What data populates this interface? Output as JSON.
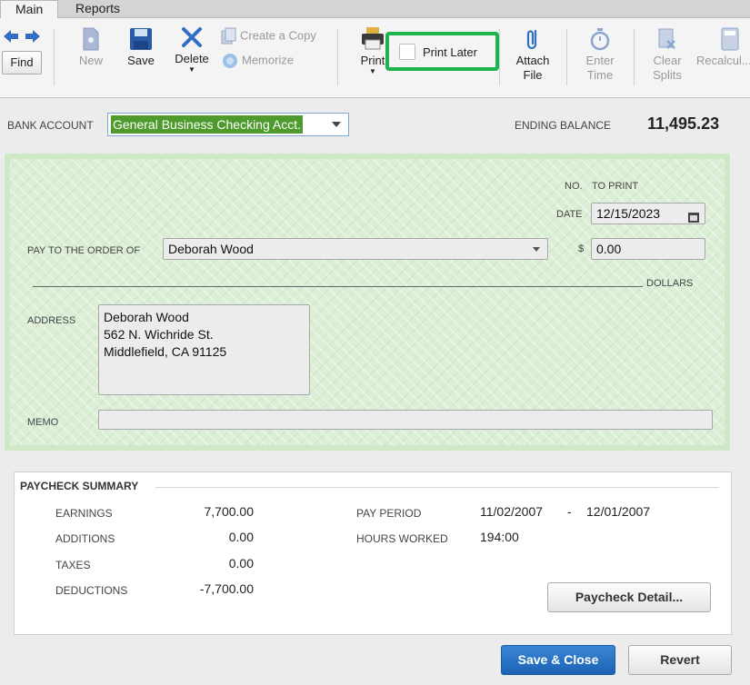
{
  "tabs": [
    {
      "label": "Main"
    },
    {
      "label": "Reports"
    }
  ],
  "toolbar": {
    "find_label": "Find",
    "new_label": "New",
    "save_label": "Save",
    "delete_label": "Delete",
    "create_copy_label": "Create a Copy",
    "memorize_label": "Memorize",
    "print_label": "Print",
    "print_later_label": "Print Later",
    "attach_label_1": "Attach",
    "attach_label_2": "File",
    "enter_label_1": "Enter",
    "enter_label_2": "Time",
    "clear_label_1": "Clear",
    "clear_label_2": "Splits",
    "recalc_label": "Recalcul..."
  },
  "bank": {
    "label": "BANK ACCOUNT",
    "value": "General Business Checking Acct.",
    "ending_balance_label": "ENDING BALANCE",
    "ending_balance": "11,495.23"
  },
  "check": {
    "no_label": "NO.",
    "no_value": "TO PRINT",
    "date_label": "DATE",
    "date_value": "12/15/2023",
    "pay_to_label": "PAY TO THE ORDER OF",
    "payee": "Deborah Wood",
    "dollar_sign": "$",
    "amount": "0.00",
    "dollars_label": "DOLLARS",
    "address_label": "ADDRESS",
    "address_lines": [
      "Deborah Wood",
      "562 N. Wichride St.",
      "Middlefield, CA 91125"
    ],
    "memo_label": "MEMO"
  },
  "summary": {
    "title": "PAYCHECK SUMMARY",
    "earnings_label": "EARNINGS",
    "earnings": "7,700.00",
    "additions_label": "ADDITIONS",
    "additions": "0.00",
    "taxes_label": "TAXES",
    "taxes": "0.00",
    "deductions_label": "DEDUCTIONS",
    "deductions": "-7,700.00",
    "pay_period_label": "PAY PERIOD",
    "pay_period_start": "11/02/2007",
    "pay_period_sep": "-",
    "pay_period_end": "12/01/2007",
    "hours_label": "HOURS WORKED",
    "hours": "194:00",
    "detail_button": "Paycheck Detail..."
  },
  "footer": {
    "save_close": "Save & Close",
    "revert": "Revert"
  },
  "colors": {
    "highlight": "#1db450",
    "primary_button": "#1c62b5",
    "selected_account": "#4e9a2c",
    "check_background": "#dcefd6"
  }
}
